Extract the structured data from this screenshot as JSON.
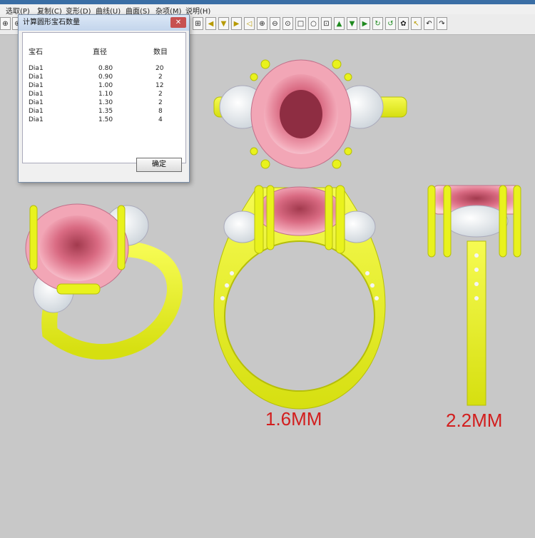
{
  "menu": {
    "items": [
      "选取(P)",
      "复制(C)",
      "变形(D)",
      "曲线(U)",
      "曲面(S)",
      "杂项(M)",
      "说明(H)"
    ]
  },
  "dialog": {
    "title": "计算圆形宝石数量",
    "close_glyph": "✕",
    "headers": {
      "stone": "宝石",
      "diameter": "直径",
      "count": "数目"
    },
    "rows": [
      {
        "stone": "Dia1",
        "diameter": "0.80",
        "count": "20"
      },
      {
        "stone": "Dia1",
        "diameter": "0.90",
        "count": "2"
      },
      {
        "stone": "Dia1",
        "diameter": "1.00",
        "count": "12"
      },
      {
        "stone": "Dia1",
        "diameter": "1.10",
        "count": "2"
      },
      {
        "stone": "Dia1",
        "diameter": "1.30",
        "count": "2"
      },
      {
        "stone": "Dia1",
        "diameter": "1.35",
        "count": "8"
      },
      {
        "stone": "Dia1",
        "diameter": "1.50",
        "count": "4"
      }
    ],
    "ok_label": "确定"
  },
  "labels": {
    "front_thickness": "1.6MM",
    "side_thickness": "2.2MM"
  },
  "colors": {
    "gold": "#e9f21d",
    "gold_dark": "#b5be0a",
    "pink_gem": "#f2a6b6",
    "gem_center": "#a23a4e",
    "white_gem": "#eef2f5",
    "label_red": "#d21e1e"
  },
  "icons": [
    "grid-icon",
    "triangle-left-icon",
    "triangle-down-icon",
    "triangle-right-icon",
    "zoom-in-icon",
    "zoom-out-icon",
    "zoom-fit-icon",
    "rectangle-icon",
    "circle-icon",
    "triangle-up-icon",
    "triangle-down-icon",
    "triangle-right-icon",
    "rotate-icon",
    "undo-icon",
    "redo-icon",
    "pointer-icon"
  ]
}
